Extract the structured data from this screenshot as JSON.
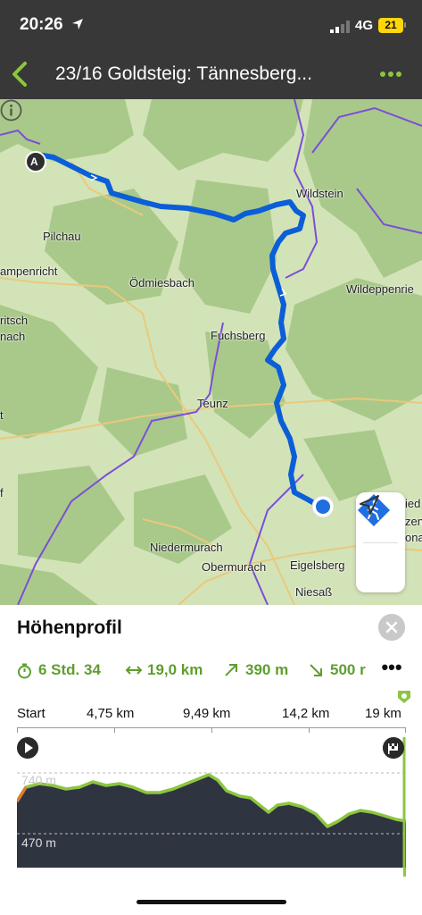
{
  "status_bar": {
    "time": "20:26",
    "network": "4G",
    "battery": "21"
  },
  "header": {
    "title": "23/16 Goldsteig: Tännesberg..."
  },
  "map": {
    "start_marker": "A",
    "places": [
      {
        "id": "pilchau",
        "label": "Pilchau"
      },
      {
        "id": "wildstein",
        "label": "Wildstein"
      },
      {
        "id": "rampenricht",
        "label": "ampenricht"
      },
      {
        "id": "oedmiesbach",
        "label": "Ödmiesbach"
      },
      {
        "id": "wildeppenried",
        "label": "Wildeppenrie"
      },
      {
        "id": "fritsch",
        "label": "ritsch"
      },
      {
        "id": "nach",
        "label": "nach"
      },
      {
        "id": "fuchsberg",
        "label": "Fuchsberg"
      },
      {
        "id": "teunz",
        "label": "Teunz"
      },
      {
        "id": "niedermurach",
        "label": "Niedermurach"
      },
      {
        "id": "obermurach",
        "label": "Obermurach"
      },
      {
        "id": "eigelsberg",
        "label": "Eigelsberg"
      },
      {
        "id": "niesass",
        "label": "Niesaß"
      },
      {
        "id": "ied",
        "label": "ied"
      },
      {
        "id": "zen",
        "label": "zen"
      },
      {
        "id": "ona",
        "label": "ona"
      },
      {
        "id": "t",
        "label": "t"
      },
      {
        "id": "f",
        "label": "f"
      }
    ]
  },
  "profile": {
    "title": "Höhenprofil",
    "stats": {
      "duration": "6 Std. 34",
      "distance": "19,0 km",
      "ascent": "390 m",
      "descent": "500 r"
    },
    "distance_ticks": [
      "Start",
      "4,75 km",
      "9,49 km",
      "14,2 km",
      "19 km"
    ],
    "elevation_ticks": [
      "740 m",
      "470 m"
    ],
    "colors": {
      "accent": "#5e9e2e",
      "profile_fill": "#2e3440",
      "profile_line": "#8cc63f",
      "route": "#0b5ed7",
      "boundary": "#7b4fd6"
    }
  }
}
